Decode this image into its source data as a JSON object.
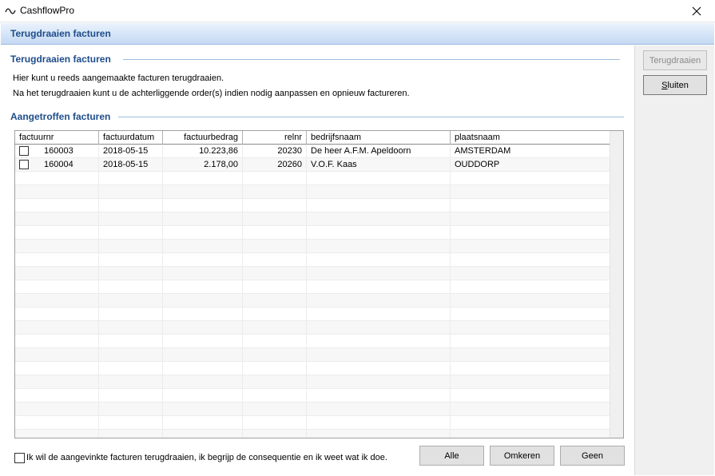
{
  "window": {
    "title": "CashflowPro",
    "header": "Terugdraaien facturen"
  },
  "section1": {
    "title": "Terugdraaien facturen",
    "line1": "Hier kunt u reeds aangemaakte facturen terugdraaien.",
    "line2": "Na het terugdraaien kunt u de achterliggende order(s) indien nodig aanpassen en opnieuw factureren."
  },
  "section2": {
    "title": "Aangetroffen facturen"
  },
  "table": {
    "columns": [
      "factuurnr",
      "factuurdatum",
      "factuurbedrag",
      "relnr",
      "bedrijfsnaam",
      "plaatsnaam"
    ],
    "rows": [
      {
        "factuurnr": "160003",
        "factuurdatum": "2018-05-15",
        "factuurbedrag": "10.223,86",
        "relnr": "20230",
        "bedrijfsnaam": "De heer A.F.M. Apeldoorn",
        "plaatsnaam": "AMSTERDAM",
        "checked": false
      },
      {
        "factuurnr": "160004",
        "factuurdatum": "2018-05-15",
        "factuurbedrag": "2.178,00",
        "relnr": "20260",
        "bedrijfsnaam": "V.O.F. Kaas",
        "plaatsnaam": "OUDDORP",
        "checked": false
      }
    ]
  },
  "side": {
    "terugdraaien": "Terugdraaien",
    "sluiten": "Sluiten"
  },
  "footer": {
    "confirm_label": "Ik wil de aangevinkte facturen terugdraaien, ik begrijp de consequentie en ik weet wat ik doe.",
    "alle": "Alle",
    "omkeren": "Omkeren",
    "geen": "Geen"
  },
  "icons": {
    "app": "cashflow-wave-icon",
    "close": "close-icon",
    "checkbox": "checkbox-icon"
  }
}
